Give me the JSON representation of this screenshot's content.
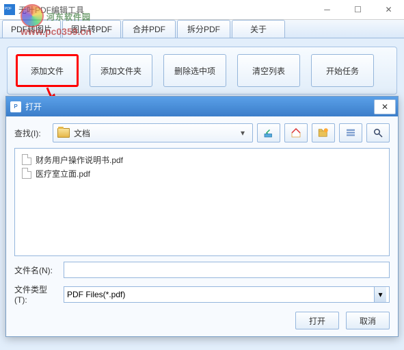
{
  "window": {
    "title": "无叶PDF编辑工具"
  },
  "watermark": {
    "site_name": "河东软件园",
    "site_url": "www.pc0359.cn"
  },
  "tabs": {
    "t0": "PDF转图片",
    "t1": "图片转PDF",
    "t2": "合并PDF",
    "t3": "拆分PDF",
    "t4": "关于"
  },
  "toolbar": {
    "add_file": "添加文件",
    "add_folder": "添加文件夹",
    "delete_selected": "删除选中项",
    "clear_list": "清空列表",
    "start_task": "开始任务"
  },
  "dialog": {
    "title": "打开",
    "lookup_label": "查找(I):",
    "lookup_folder": "文档",
    "files": {
      "f0": "财务用户操作说明书.pdf",
      "f1": "医疗室立面.pdf"
    },
    "filename_label": "文件名(N):",
    "filename_value": "",
    "filetype_label": "文件类型(T):",
    "filetype_value": "PDF Files(*.pdf)",
    "open_btn": "打开",
    "cancel_btn": "取消"
  }
}
